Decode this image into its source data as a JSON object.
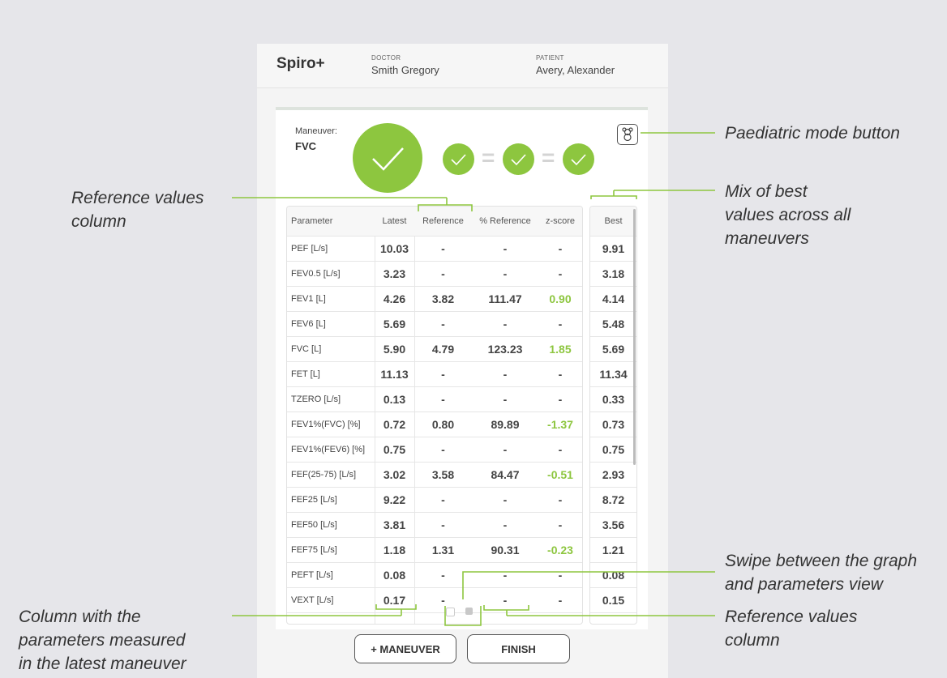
{
  "app": {
    "title": "Spiro+"
  },
  "header": {
    "doctor_label": "DOCTOR",
    "doctor_name": "Smith Gregory",
    "patient_label": "PATIENT",
    "patient_name": "Avery, Alexander"
  },
  "maneuver": {
    "label": "Maneuver:",
    "value": "FVC"
  },
  "table": {
    "headers": [
      "Parameter",
      "Latest",
      "Reference",
      "% Reference",
      "z-score"
    ],
    "best_header": "Best",
    "rows": [
      {
        "param": "PEF [L/s]",
        "latest": "10.03",
        "ref": "-",
        "pct": "-",
        "z": "-",
        "best": "9.91"
      },
      {
        "param": "FEV0.5 [L/s]",
        "latest": "3.23",
        "ref": "-",
        "pct": "-",
        "z": "-",
        "best": "3.18"
      },
      {
        "param": "FEV1 [L]",
        "latest": "4.26",
        "ref": "3.82",
        "pct": "111.47",
        "z": "0.90",
        "best": "4.14"
      },
      {
        "param": "FEV6 [L]",
        "latest": "5.69",
        "ref": "-",
        "pct": "-",
        "z": "-",
        "best": "5.48"
      },
      {
        "param": "FVC [L]",
        "latest": "5.90",
        "ref": "4.79",
        "pct": "123.23",
        "z": "1.85",
        "best": "5.69"
      },
      {
        "param": "FET [L]",
        "latest": "11.13",
        "ref": "-",
        "pct": "-",
        "z": "-",
        "best": "11.34"
      },
      {
        "param": "TZERO [L/s]",
        "latest": "0.13",
        "ref": "-",
        "pct": "-",
        "z": "-",
        "best": "0.33"
      },
      {
        "param": "FEV1%(FVC) [%]",
        "latest": "0.72",
        "ref": "0.80",
        "pct": "89.89",
        "z": "-1.37",
        "best": "0.73"
      },
      {
        "param": "FEV1%(FEV6) [%]",
        "latest": "0.75",
        "ref": "-",
        "pct": "-",
        "z": "-",
        "best": "0.75"
      },
      {
        "param": "FEF(25-75) [L/s]",
        "latest": "3.02",
        "ref": "3.58",
        "pct": "84.47",
        "z": "-0.51",
        "best": "2.93"
      },
      {
        "param": "FEF25 [L/s]",
        "latest": "9.22",
        "ref": "-",
        "pct": "-",
        "z": "-",
        "best": "8.72"
      },
      {
        "param": "FEF50 [L/s]",
        "latest": "3.81",
        "ref": "-",
        "pct": "-",
        "z": "-",
        "best": "3.56"
      },
      {
        "param": "FEF75 [L/s]",
        "latest": "1.18",
        "ref": "1.31",
        "pct": "90.31",
        "z": "-0.23",
        "best": "1.21"
      },
      {
        "param": "PEFT [L/s]",
        "latest": "0.08",
        "ref": "-",
        "pct": "-",
        "z": "-",
        "best": "0.08"
      },
      {
        "param": "VEXT [L/s]",
        "latest": "0.17",
        "ref": "-",
        "pct": "-",
        "z": "-",
        "best": "0.15"
      }
    ]
  },
  "buttons": {
    "maneuver": "+ MANEUVER",
    "finish": "FINISH"
  },
  "annotations": {
    "paediatric": "Paediatric mode button",
    "reference_top": [
      "Reference values",
      "column"
    ],
    "best_mix": [
      "Mix of best",
      "values across all",
      "maneuvers"
    ],
    "swipe": [
      "Swipe between the graph",
      "and parameters view"
    ],
    "latest_col": [
      "Column with the",
      "parameters measured",
      "in the latest maneuver"
    ],
    "reference_bottom": [
      "Reference values",
      "column"
    ]
  },
  "colors": {
    "accent": "#8dc63f",
    "text": "#333333"
  }
}
